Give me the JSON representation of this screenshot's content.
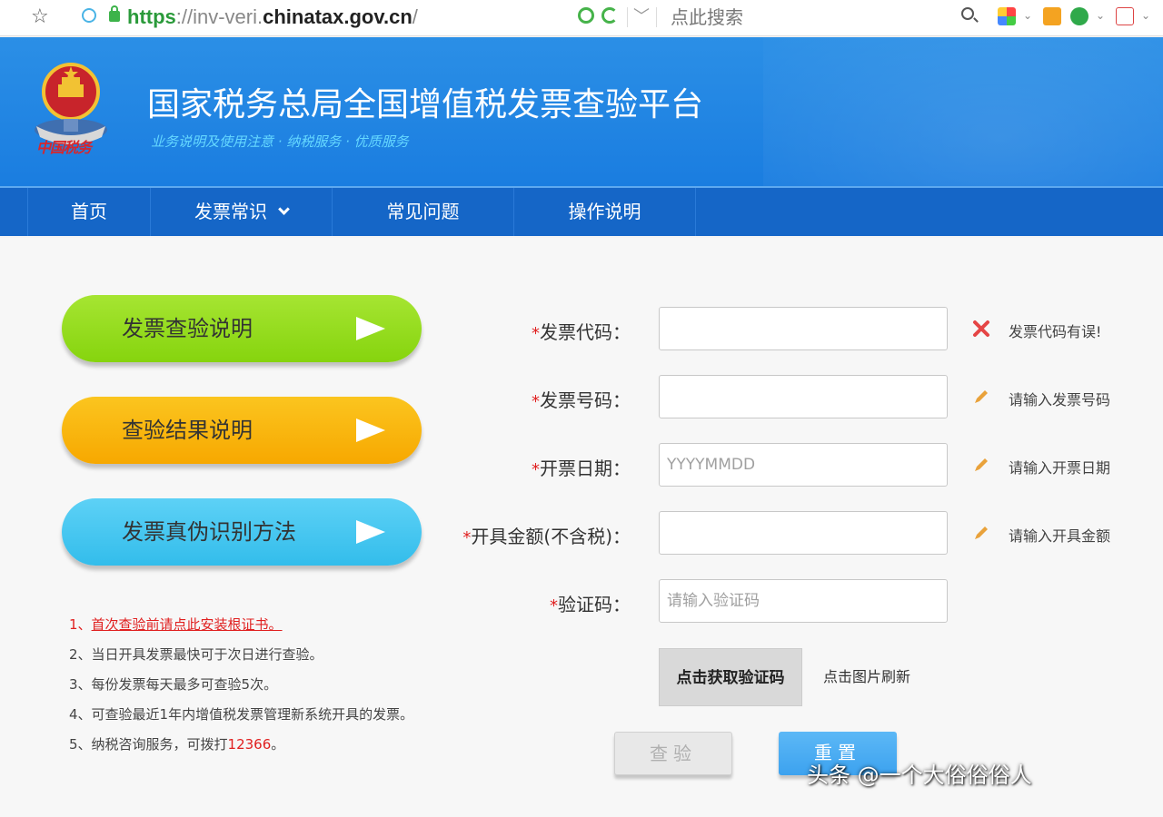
{
  "browser": {
    "url_protocol": "https",
    "url_middle": "://inv-veri.",
    "url_domain": "chinatax.gov.cn",
    "url_tail": "/",
    "search_placeholder": "点此搜索"
  },
  "header": {
    "title": "国家税务总局全国增值税发票查验平台",
    "slogan": "业务说明及使用注意 · 纳税服务 · 优质服务",
    "emblem_text": "中国税务"
  },
  "nav": {
    "items": [
      {
        "label": "首页"
      },
      {
        "label": "发票常识",
        "has_dropdown": true
      },
      {
        "label": "常见问题"
      },
      {
        "label": "操作说明"
      }
    ]
  },
  "sidebar": {
    "buttons": [
      {
        "label": "发票查验说明",
        "color": "#93dc1f"
      },
      {
        "label": "查验结果说明",
        "color": "#f9b80c"
      },
      {
        "label": "发票真伪识别方法",
        "color": "#47c7f0"
      }
    ],
    "notes": [
      {
        "prefix": "1、",
        "text": "首次查验前请点此安装根证书。"
      },
      {
        "text": "2、当日开具发票最快可于次日进行查验。"
      },
      {
        "text": "3、每份发票每天最多可查验5次。"
      },
      {
        "text": "4、可查验最近1年内增值税发票管理新系统开具的发票。"
      },
      {
        "text": "5、纳税咨询服务，可拨打",
        "phone": "12366",
        "suffix": "。"
      }
    ]
  },
  "form": {
    "required_mark": "*",
    "fields": [
      {
        "label": "发票代码：",
        "value": "",
        "placeholder": "",
        "hint": "发票代码有误!",
        "hint_type": "error"
      },
      {
        "label": "发票号码：",
        "value": "",
        "placeholder": "",
        "hint": "请输入发票号码",
        "hint_type": "edit"
      },
      {
        "label": "开票日期：",
        "value": "",
        "placeholder": "YYYYMMDD",
        "hint": "请输入开票日期",
        "hint_type": "edit"
      },
      {
        "label": "开具金额(不含税)：",
        "value": "",
        "placeholder": "",
        "hint": "请输入开具金额",
        "hint_type": "edit"
      },
      {
        "label": "验证码：",
        "value": "",
        "placeholder": "请输入验证码",
        "hint": "",
        "hint_type": "none"
      }
    ],
    "captcha_image_text": "点击获取验证码",
    "captcha_hint": "点击图片刷新",
    "check_button": "查验",
    "reset_button": "重置"
  },
  "watermark": {
    "text": "头条 @一个大俗俗俗人"
  },
  "colors": {
    "header_blue": "#1f86e4",
    "nav_blue": "#1566c7",
    "error_red": "#e02020",
    "pencil_orange": "#e9a23b"
  }
}
